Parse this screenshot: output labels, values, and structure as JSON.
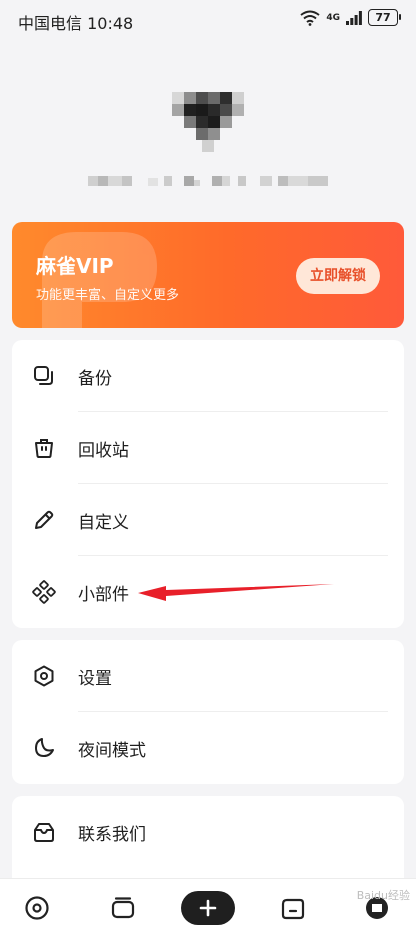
{
  "status_bar": {
    "carrier_time": "中国电信 10:48",
    "signal": "4G",
    "battery": "77"
  },
  "vip": {
    "title": "麻雀VIP",
    "subtitle": "功能更丰富、自定义更多",
    "button": "立即解锁"
  },
  "menu_group_1": [
    {
      "label": "备份",
      "icon": "backup-icon"
    },
    {
      "label": "回收站",
      "icon": "trash-icon"
    },
    {
      "label": "自定义",
      "icon": "edit-icon"
    },
    {
      "label": "小部件",
      "icon": "widget-icon"
    }
  ],
  "menu_group_2": [
    {
      "label": "设置",
      "icon": "settings-icon"
    },
    {
      "label": "夜间模式",
      "icon": "moon-icon"
    }
  ],
  "menu_group_3": [
    {
      "label": "联系我们",
      "icon": "contact-icon"
    }
  ],
  "colors": {
    "vip_start": "#ff8a2c",
    "vip_end": "#ff5a3a",
    "arrow": "#e8202a"
  },
  "watermark": "Baidu经验"
}
